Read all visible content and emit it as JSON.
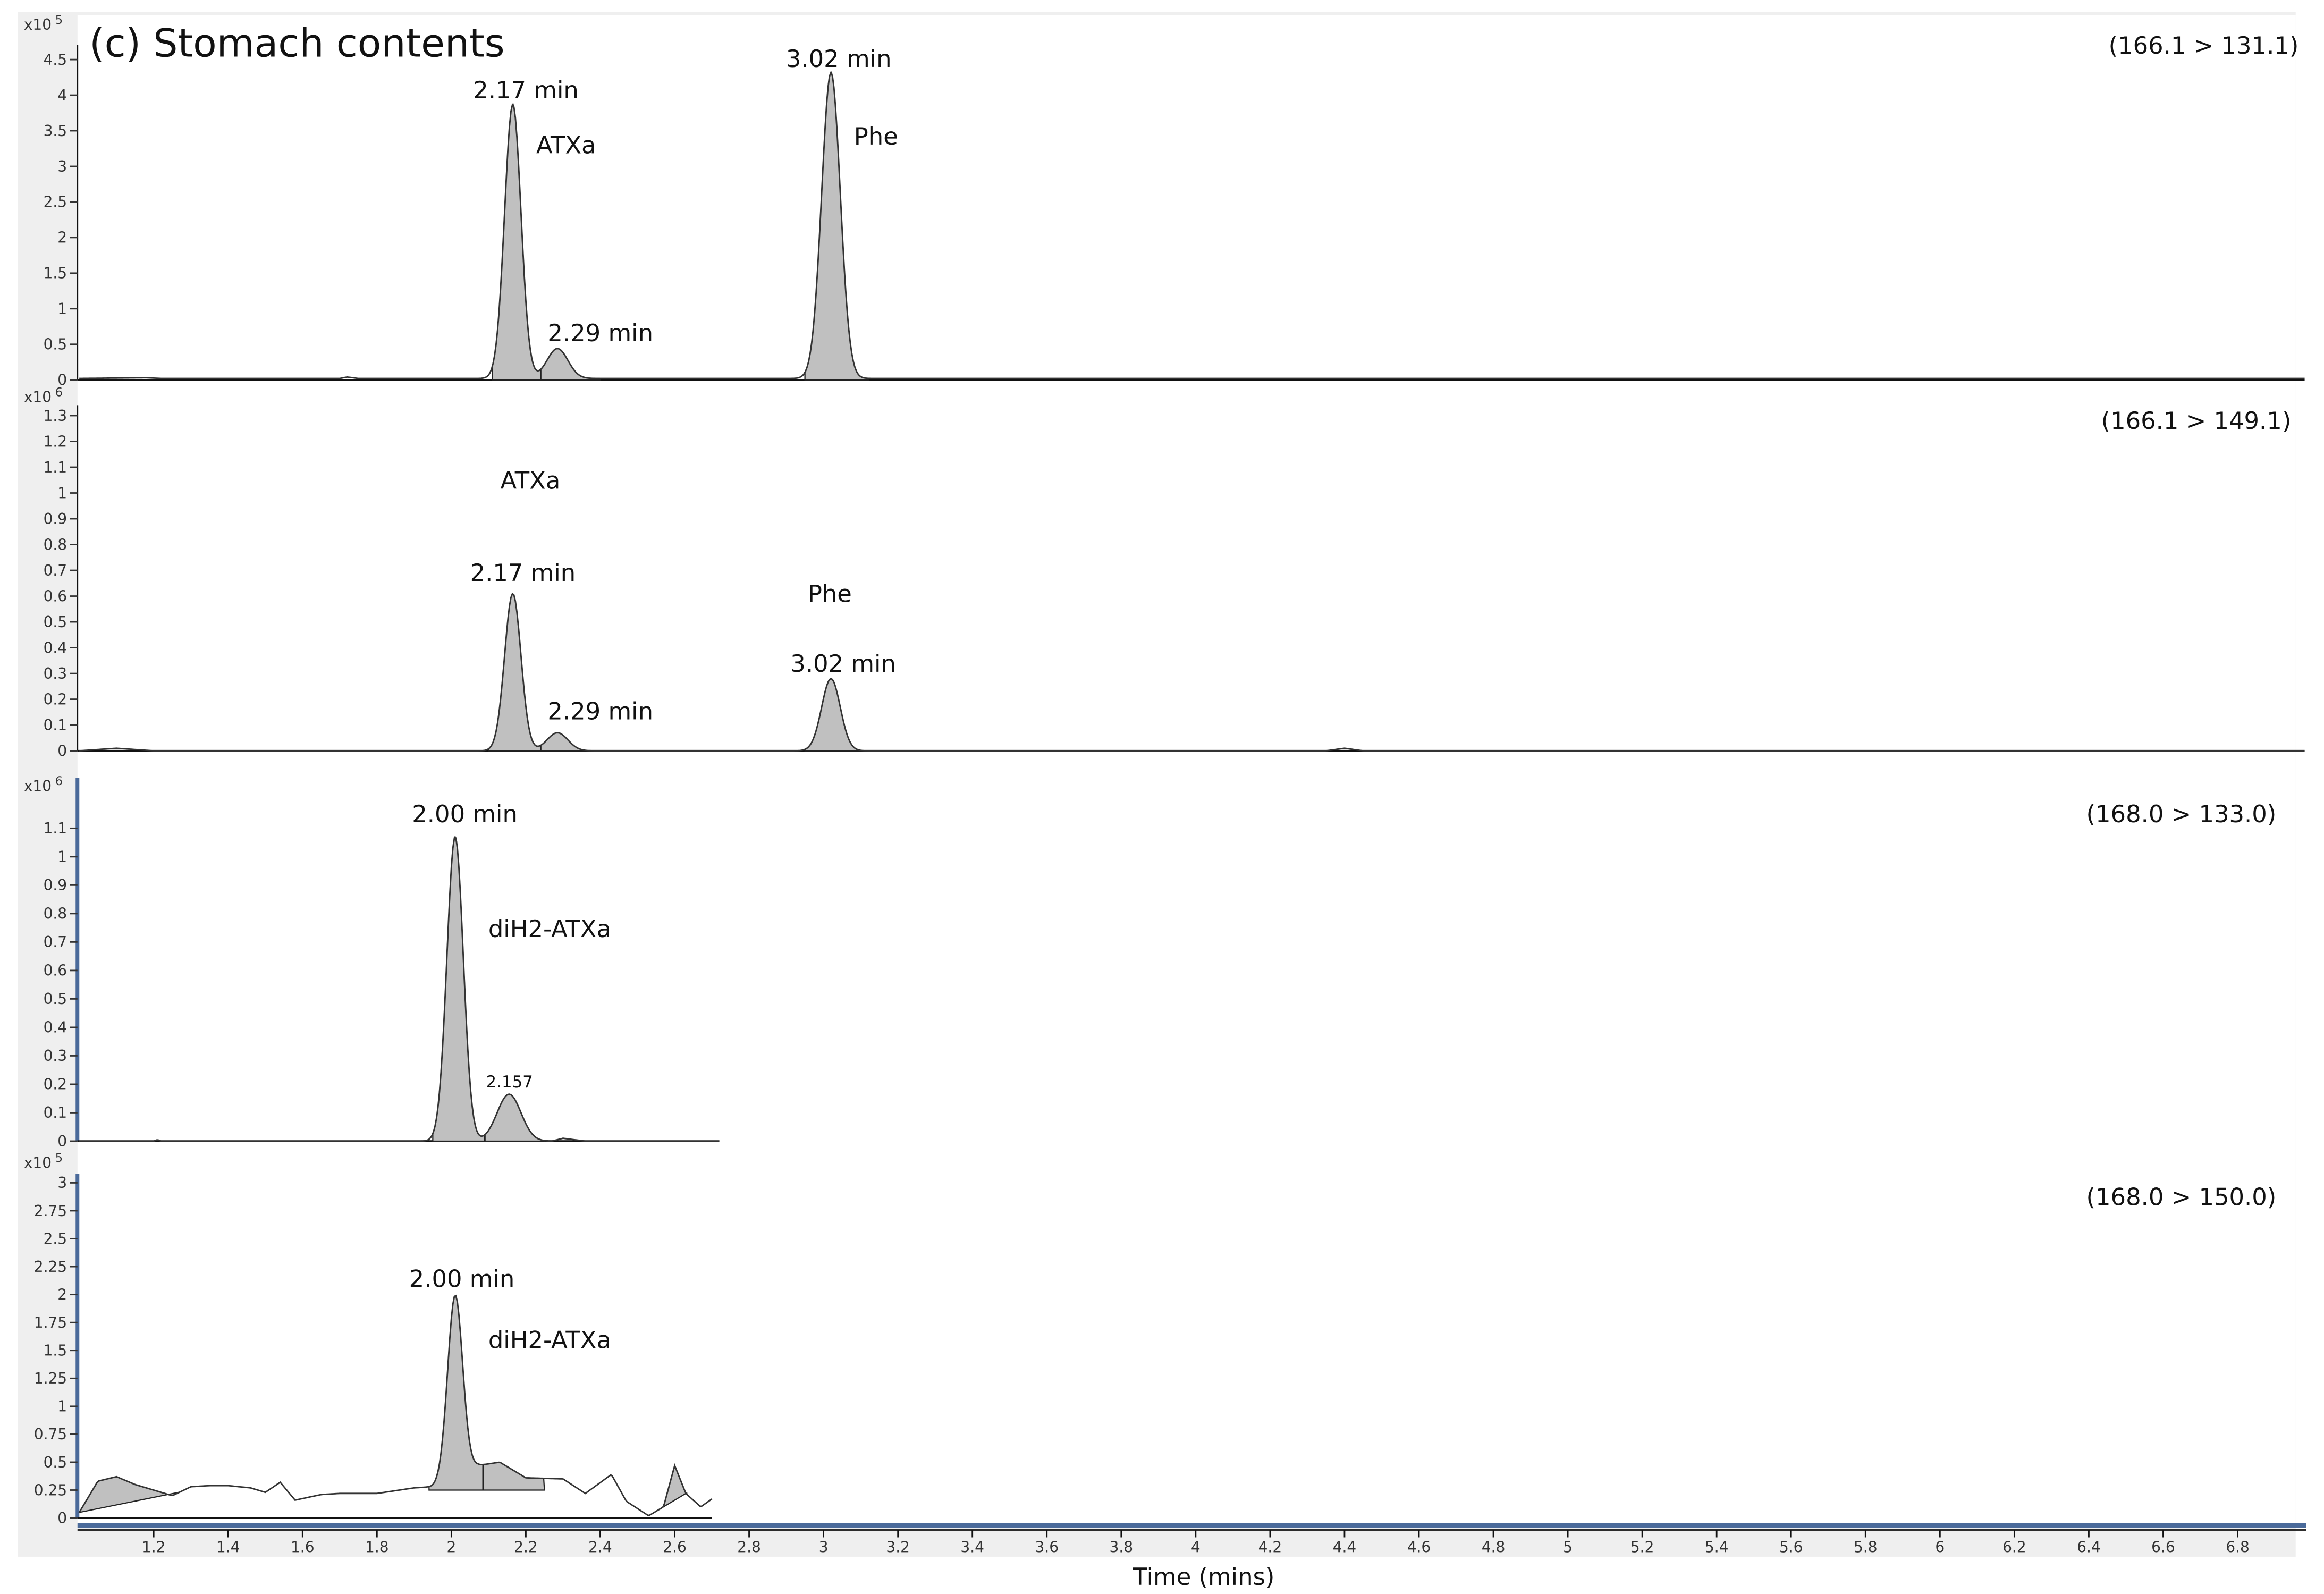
{
  "figure_title": "(c) Stomach contents",
  "x_axis": {
    "label": "Time (mins)",
    "range": [
      1.0,
      6.98
    ],
    "ticks": [
      "1.2",
      "1.4",
      "1.6",
      "1.8",
      "2",
      "2.2",
      "2.4",
      "2.6",
      "2.8",
      "3",
      "3.2",
      "3.4",
      "3.6",
      "3.8",
      "4",
      "4.2",
      "4.4",
      "4.6",
      "4.8",
      "5",
      "5.2",
      "5.4",
      "5.6",
      "5.8",
      "6",
      "6.2",
      "6.4",
      "6.6",
      "6.8"
    ]
  },
  "colors": {
    "fill": "#c0c0c0",
    "trace": "#333333",
    "axis_blue": "#4a6a9a",
    "panel_bg": "#efefef"
  },
  "chart_data": [
    {
      "type": "line",
      "transition": "(166.1 > 131.1)",
      "y_scale": {
        "base": "x10",
        "exponent": "5"
      },
      "ylim": [
        0,
        4.5
      ],
      "yticks": [
        "0",
        "0.5",
        "1",
        "1.5",
        "2",
        "2.5",
        "3",
        "3.5",
        "4",
        "4.5"
      ],
      "ytick_values": [
        0,
        0.5,
        1,
        1.5,
        2,
        2.5,
        3,
        3.5,
        4,
        4.5
      ],
      "x_end": 6.98,
      "baseline": [
        [
          1.0,
          0.02
        ],
        [
          1.18,
          0.03
        ],
        [
          1.22,
          0.02
        ],
        [
          1.7,
          0.02
        ],
        [
          1.72,
          0.04
        ],
        [
          1.75,
          0.02
        ],
        [
          6.98,
          0.02
        ]
      ],
      "peaks": [
        {
          "rt": 2.165,
          "height": 3.85,
          "sigma": 0.022
        },
        {
          "rt": 2.285,
          "height": 0.42,
          "sigma": 0.028
        },
        {
          "rt": 3.02,
          "height": 4.3,
          "sigma": 0.025
        }
      ],
      "fills": [
        [
          2.11,
          2.4,
          2.24
        ],
        [
          2.95,
          3.12,
          null
        ]
      ],
      "annotations": [
        "2.17 min",
        "ATXa",
        "2.29 min",
        "3.02 min",
        "Phe"
      ]
    },
    {
      "type": "line",
      "transition": "(166.1 > 149.1)",
      "y_scale": {
        "base": "x10",
        "exponent": "6"
      },
      "ylim": [
        0,
        1.3
      ],
      "yticks": [
        "0",
        "0.1",
        "0.2",
        "0.3",
        "0.4",
        "0.5",
        "0.6",
        "0.7",
        "0.8",
        "0.9",
        "1",
        "1.1",
        "1.2",
        "1.3"
      ],
      "ytick_values": [
        0,
        0.1,
        0.2,
        0.3,
        0.4,
        0.5,
        0.6,
        0.7,
        0.8,
        0.9,
        1,
        1.1,
        1.2,
        1.3
      ],
      "x_end": 6.98,
      "baseline": [
        [
          1.0,
          0.0
        ],
        [
          1.1,
          0.01
        ],
        [
          1.2,
          0.0
        ],
        [
          4.35,
          0.0
        ],
        [
          4.4,
          0.01
        ],
        [
          4.45,
          0.0
        ],
        [
          6.98,
          0.0
        ]
      ],
      "peaks": [
        {
          "rt": 2.165,
          "height": 0.61,
          "sigma": 0.022
        },
        {
          "rt": 2.285,
          "height": 0.07,
          "sigma": 0.028
        },
        {
          "rt": 3.02,
          "height": 0.28,
          "sigma": 0.025
        }
      ],
      "fills": [
        [
          2.1,
          2.4,
          2.24
        ],
        [
          2.95,
          3.12,
          null
        ]
      ],
      "annotations": [
        "ATXa",
        "2.17 min",
        "2.29 min",
        "Phe",
        "3.02 min"
      ]
    },
    {
      "type": "line",
      "transition": "(168.0 > 133.0)",
      "y_scale": {
        "base": "x10",
        "exponent": "6"
      },
      "ylim": [
        0,
        1.1
      ],
      "yticks": [
        "0",
        "0.1",
        "0.2",
        "0.3",
        "0.4",
        "0.5",
        "0.6",
        "0.7",
        "0.8",
        "0.9",
        "1",
        "1.1"
      ],
      "ytick_values": [
        0,
        0.1,
        0.2,
        0.3,
        0.4,
        0.5,
        0.6,
        0.7,
        0.8,
        0.9,
        1,
        1.1
      ],
      "x_end": 2.72,
      "baseline": [
        [
          1.0,
          0.0
        ],
        [
          1.2,
          0.0
        ],
        [
          1.21,
          0.005
        ],
        [
          1.22,
          0.0
        ],
        [
          2.27,
          0.0
        ],
        [
          2.3,
          0.01
        ],
        [
          2.36,
          0.0
        ],
        [
          2.72,
          0.0
        ]
      ],
      "peaks": [
        {
          "rt": 2.01,
          "height": 1.07,
          "sigma": 0.022
        },
        {
          "rt": 2.155,
          "height": 0.165,
          "sigma": 0.032
        }
      ],
      "fills": [
        [
          1.95,
          2.25,
          2.09
        ]
      ],
      "annotations": [
        "2.00 min",
        "diH2-ATXa",
        "2.157"
      ]
    },
    {
      "type": "line",
      "transition": "(168.0 > 150.0)",
      "y_scale": {
        "base": "x10",
        "exponent": "5"
      },
      "ylim": [
        0,
        3
      ],
      "yticks": [
        "0",
        "0.25",
        "0.5",
        "0.75",
        "1",
        "1.25",
        "1.5",
        "1.75",
        "2",
        "2.25",
        "2.5",
        "2.75",
        "3"
      ],
      "ytick_values": [
        0,
        0.25,
        0.5,
        0.75,
        1,
        1.25,
        1.5,
        1.75,
        2,
        2.25,
        2.5,
        2.75,
        3
      ],
      "x_end": 2.7,
      "baseline": [
        [
          1.0,
          0.05
        ],
        [
          1.05,
          0.33
        ],
        [
          1.1,
          0.37
        ],
        [
          1.15,
          0.3
        ],
        [
          1.2,
          0.25
        ],
        [
          1.25,
          0.2
        ],
        [
          1.3,
          0.28
        ],
        [
          1.35,
          0.29
        ],
        [
          1.4,
          0.29
        ],
        [
          1.46,
          0.27
        ],
        [
          1.5,
          0.23
        ],
        [
          1.54,
          0.32
        ],
        [
          1.58,
          0.16
        ],
        [
          1.65,
          0.21
        ],
        [
          1.7,
          0.22
        ],
        [
          1.8,
          0.22
        ],
        [
          1.9,
          0.27
        ],
        [
          1.95,
          0.28
        ],
        [
          2.07,
          0.47
        ],
        [
          2.13,
          0.5
        ],
        [
          2.2,
          0.36
        ],
        [
          2.3,
          0.35
        ],
        [
          2.36,
          0.22
        ],
        [
          2.43,
          0.39
        ],
        [
          2.47,
          0.15
        ],
        [
          2.53,
          0.02
        ],
        [
          2.57,
          0.1
        ],
        [
          2.6,
          0.47
        ],
        [
          2.63,
          0.22
        ],
        [
          2.67,
          0.1
        ],
        [
          2.7,
          0.17
        ]
      ],
      "peaks": [
        {
          "rt": 2.01,
          "height": 1.62,
          "sigma": 0.02
        }
      ],
      "fills": [
        [
          1.94,
          2.25,
          2.085,
          0.25
        ],
        [
          1.0,
          1.27,
          null,
          "ramp"
        ],
        [
          2.57,
          2.63,
          null,
          "ramp"
        ]
      ],
      "annotations": [
        "2.00 min",
        "diH2-ATXa"
      ]
    }
  ]
}
